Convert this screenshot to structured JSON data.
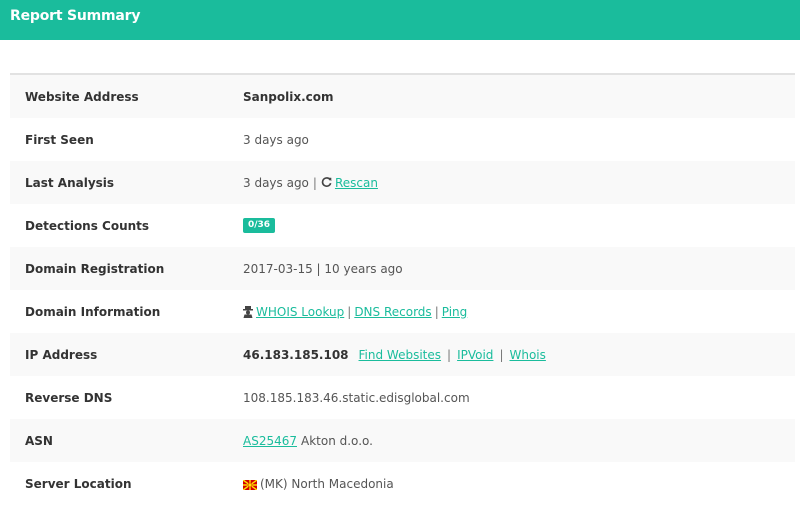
{
  "header": {
    "title": "Report Summary"
  },
  "rows": {
    "website": {
      "label": "Website Address",
      "value": "Sanpolix.com"
    },
    "first_seen": {
      "label": "First Seen",
      "value": "3 days ago"
    },
    "last_analysis": {
      "label": "Last Analysis",
      "value": "3 days ago",
      "separator": "|",
      "rescan": "Rescan"
    },
    "detections": {
      "label": "Detections Counts",
      "badge": "0/36"
    },
    "domain_registration": {
      "label": "Domain Registration",
      "value": "2017-03-15 | 10 years ago"
    },
    "domain_info": {
      "label": "Domain Information",
      "whois": "WHOIS Lookup",
      "sep1": "|",
      "dns": "DNS Records",
      "sep2": "|",
      "ping": "Ping"
    },
    "ip": {
      "label": "IP Address",
      "value": "46.183.185.108",
      "find": "Find Websites",
      "sep1": "|",
      "ipvoid": "IPVoid",
      "sep2": "|",
      "whois": "Whois"
    },
    "reverse_dns": {
      "label": "Reverse DNS",
      "value": "108.185.183.46.static.edisglobal.com"
    },
    "asn": {
      "label": "ASN",
      "link": "AS25467",
      "name": "Akton d.o.o."
    },
    "server_location": {
      "label": "Server Location",
      "value": "(MK) North Macedonia"
    }
  },
  "icons": {
    "rescan": "refresh-icon",
    "whois": "user-secret-icon",
    "flag": "flag-mk-icon"
  },
  "colors": {
    "accent": "#1abc9c"
  }
}
